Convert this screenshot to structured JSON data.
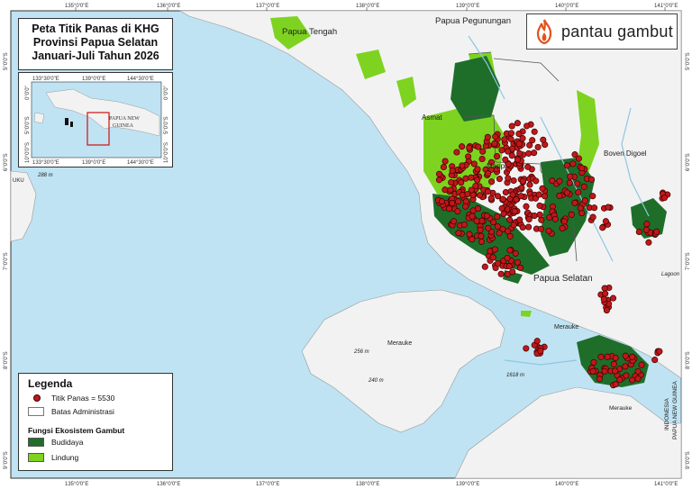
{
  "title": {
    "line1": "Peta Titik Panas di KHG",
    "line2": "Provinsi Papua Selatan",
    "line3": "Januari-Juli Tahun 2026"
  },
  "brand": {
    "name": "pantau gambut",
    "color": "#e2521f",
    "icon": "flame-icon"
  },
  "grid_labels": {
    "top": [
      "135°0'0\"E",
      "136°0'0\"E",
      "137°0'0\"E",
      "138°0'0\"E",
      "139°0'0\"E",
      "140°0'0\"E",
      "141°0'0\"E"
    ],
    "bottom": [
      "135°0'0\"E",
      "136°0'0\"E",
      "137°0'0\"E",
      "138°0'0\"E",
      "139°0'0\"E",
      "140°0'0\"E",
      "141°0'0\"E"
    ],
    "left": [
      "5°0'0\"S",
      "6°0'0\"S",
      "7°0'0\"S",
      "8°0'0\"S",
      "9°0'0\"S"
    ],
    "right": [
      "5°0'0\"S",
      "6°0'0\"S",
      "7°0'0\"S",
      "8°0'0\"S",
      "9°0'0\"S"
    ]
  },
  "places": {
    "papua_tengah": "Papua Tengah",
    "papua_pegunungan": "Papua Pegunungan",
    "asmat": "Asmat",
    "mappi": "Mappi",
    "boven_digoel": "Boven Digoel",
    "papua_selatan": "Papua Selatan",
    "merauke_island": "Merauke",
    "merauke_mid": "Merauke",
    "merauke_se": "Merauke",
    "png_side": "PAPUA NEW GUINEA",
    "indonesia_side": "INDONESIA",
    "lagoon": "Lagoon",
    "uku": "UKU",
    "depth_288": "288 m",
    "depth_256": "256 m",
    "depth_240": "240 m",
    "depth_1618": "1618 m"
  },
  "inset": {
    "ticks_top": [
      "133°30'0\"E",
      "139°0'0\"E",
      "144°30'0\"E"
    ],
    "ticks_bottom": [
      "133°30'0\"E",
      "139°0'0\"E",
      "144°30'0\"E"
    ],
    "ticks_left": [
      "0°0'0\"",
      "5°0'0\"S",
      "10°0'0\"S"
    ],
    "ticks_right": [
      "0°0'0\"",
      "5°0'0\"S",
      "10°0'0\"S"
    ],
    "png_label_1": "PAPUA NEW",
    "png_label_2": "GUINEA"
  },
  "legend": {
    "title": "Legenda",
    "hotspot_label": "Titik Panas = 5530",
    "admin_label": "Batas Administrasi",
    "ecosystem_title": "Fungsi Ekosistem Gambut",
    "budidaya_label": "Budidaya",
    "lindung_label": "Lindung"
  },
  "colors": {
    "sea": "#bfe3f3",
    "land": "#f2f2f2",
    "budidaya": "#1e6e2a",
    "lindung": "#7ed321",
    "hotspot": "#c0181a",
    "hotspot_outline": "#3a0000",
    "inset_box": "#d01010"
  }
}
